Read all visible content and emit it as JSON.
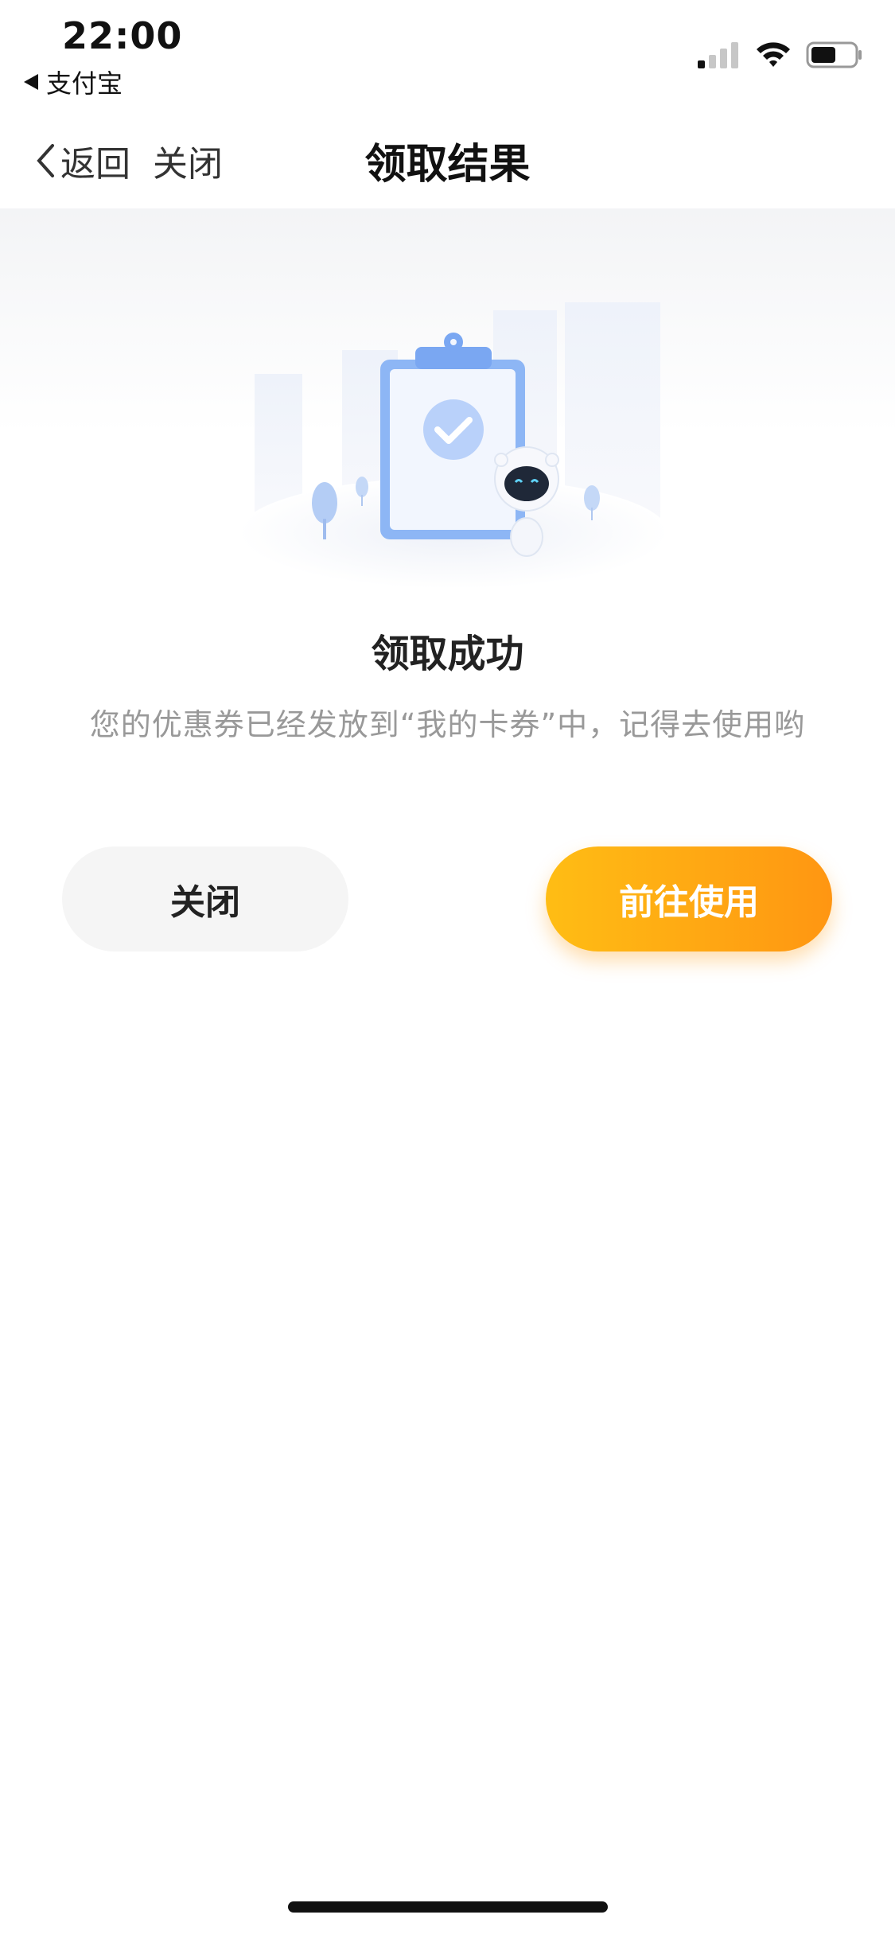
{
  "status_bar": {
    "time": "22:00",
    "back_app": "支付宝"
  },
  "nav": {
    "back_label": "返回",
    "close_label": "关闭",
    "title": "领取结果"
  },
  "result": {
    "title": "领取成功",
    "description": "您的优惠券已经发放到“我的卡券”中，记得去使用哟"
  },
  "actions": {
    "close_label": "关闭",
    "use_label": "前往使用"
  },
  "colors": {
    "accent_start": "#ffbd14",
    "accent_end": "#ff9612",
    "hero_blue": "#8db6f5"
  }
}
